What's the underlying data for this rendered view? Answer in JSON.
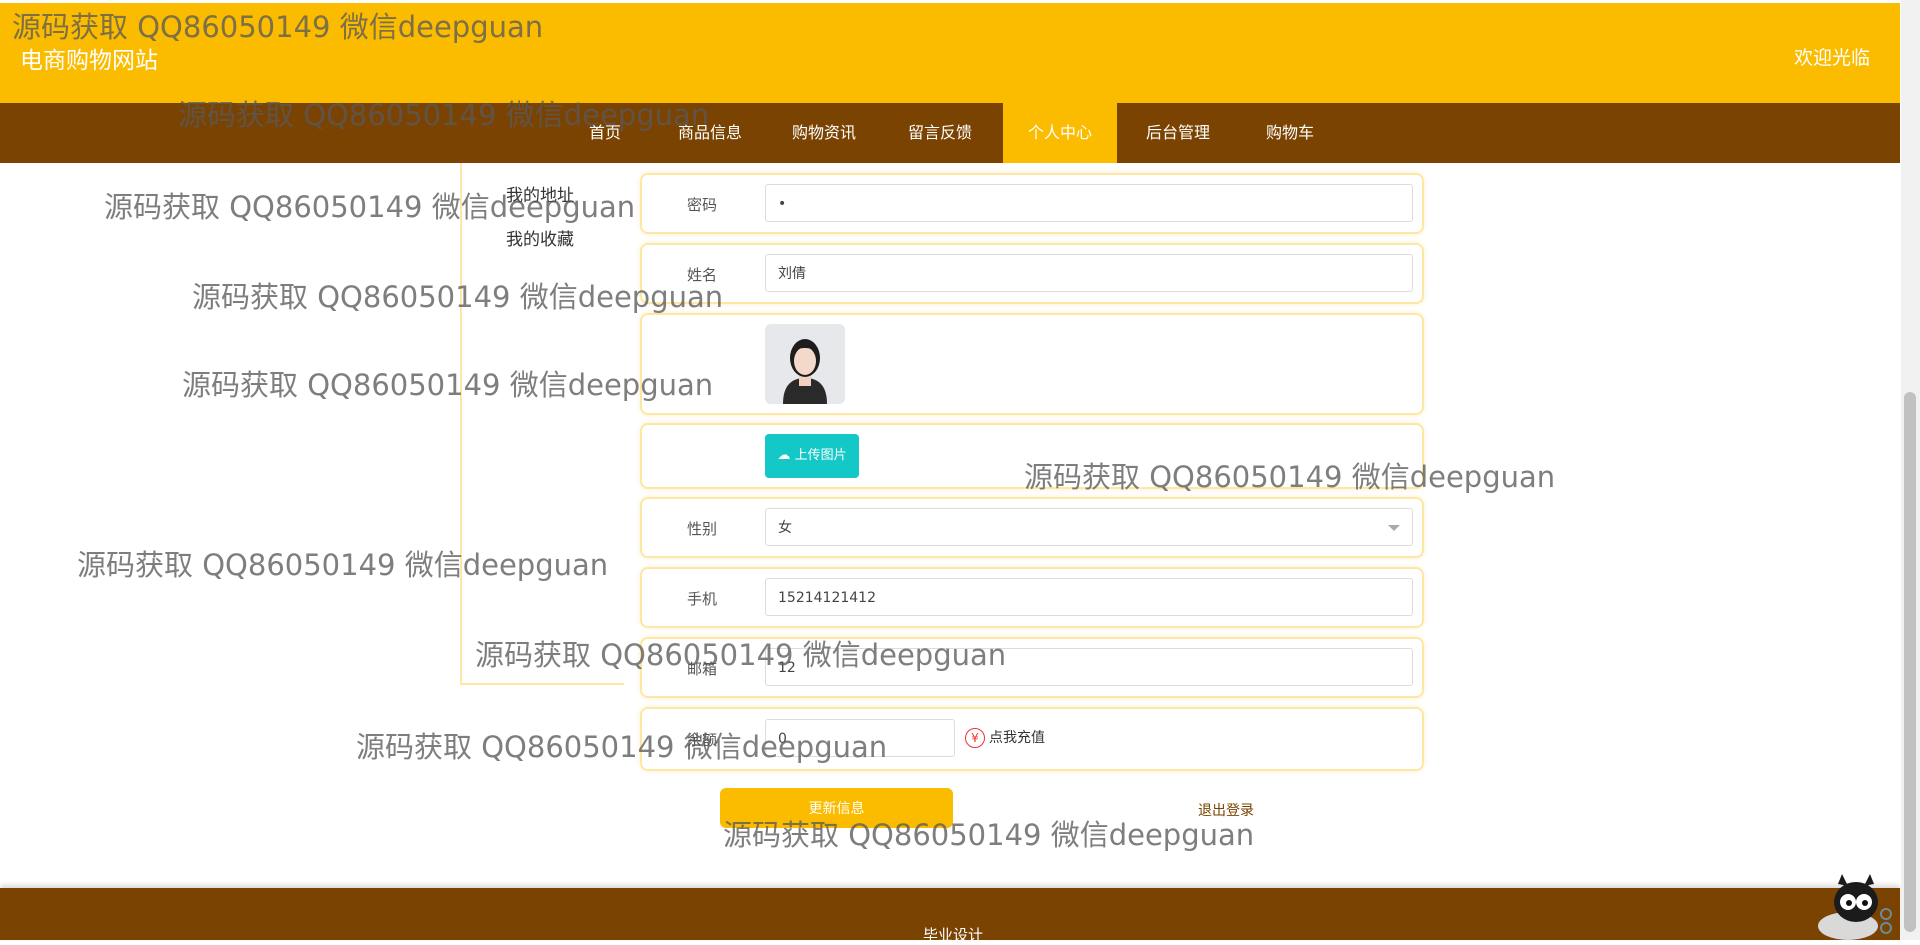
{
  "header": {
    "site_title": "电商购物网站",
    "welcome": "欢迎光临"
  },
  "nav": {
    "items": [
      "首页",
      "商品信息",
      "购物资讯",
      "留言反馈",
      "个人中心",
      "后台管理",
      "购物车"
    ],
    "active": "个人中心"
  },
  "sidebar": {
    "items": [
      "我的地址",
      "我的收藏"
    ]
  },
  "form": {
    "password": {
      "label": "密码",
      "value": "•"
    },
    "name": {
      "label": "姓名",
      "value": "刘倩"
    },
    "upload_label": "上传图片",
    "gender": {
      "label": "性别",
      "value": "女"
    },
    "phone": {
      "label": "手机",
      "value": "15214121412"
    },
    "email": {
      "label": "邮箱",
      "value": "12"
    },
    "balance": {
      "label": "余额",
      "value": "0",
      "recharge": "点我充值"
    }
  },
  "actions": {
    "update": "更新信息",
    "logout": "退出登录"
  },
  "footer": {
    "text": "毕业设计"
  },
  "watermark": "源码获取 QQ86050149 微信deepguan",
  "colors": {
    "primary": "#fbbc00",
    "nav_bg": "#7a4302",
    "upload": "#15c8c8"
  },
  "icons": {
    "upload": "cloud-upload-icon",
    "recharge": "yen-icon"
  }
}
